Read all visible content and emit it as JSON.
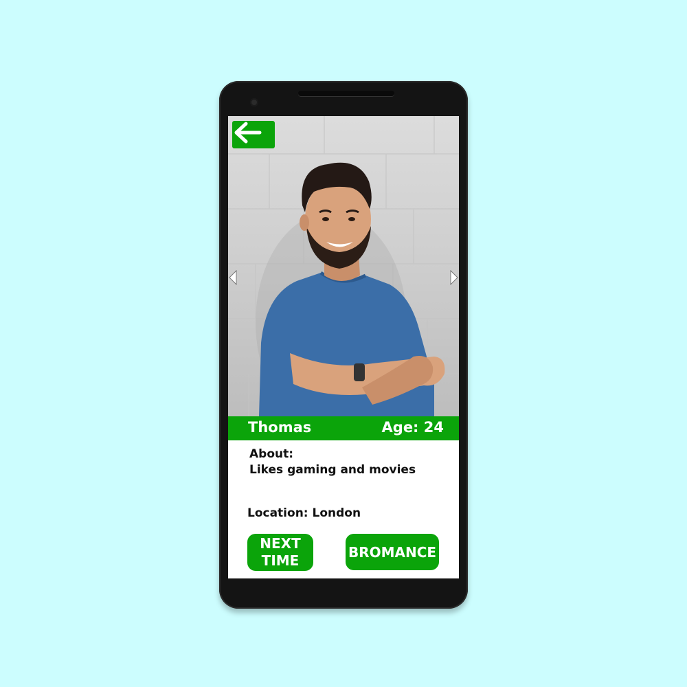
{
  "profile": {
    "name": "Thomas",
    "age_label": "Age: 24",
    "about_heading": "About:",
    "about_text": "Likes gaming and movies",
    "location": "Location: London"
  },
  "actions": {
    "next_time_label": "NEXT TIME",
    "bromance_label": "BROMANCE"
  },
  "icons": {
    "back": "arrow-left-icon",
    "prev": "triangle-left-icon",
    "next": "triangle-right-icon"
  },
  "colors": {
    "background": "#ccfdfe",
    "accent_green": "#0ba40a",
    "phone_body": "#141414"
  }
}
